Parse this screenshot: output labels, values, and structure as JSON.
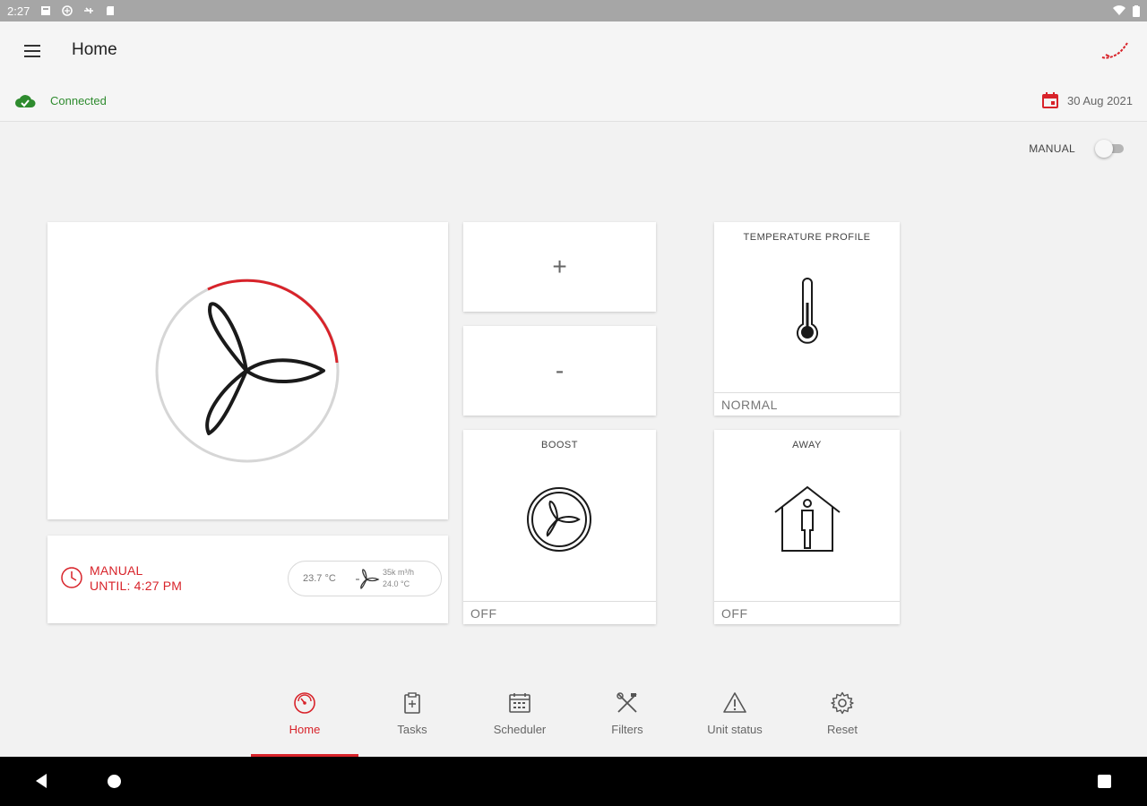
{
  "status_bar": {
    "time": "2:27"
  },
  "app_bar": {
    "title": "Home"
  },
  "connection": {
    "status": "Connected"
  },
  "date": "30 Aug 2021",
  "manual_toggle": {
    "label": "MANUAL",
    "on": false
  },
  "status_card": {
    "mode": "MANUAL",
    "until": "UNTIL: 4:27 PM",
    "temp_in": "23.7 °C",
    "airflow": "35k m³/h",
    "temp_out": "24.0 °C"
  },
  "controls": {
    "plus": "+",
    "minus": "-"
  },
  "boost": {
    "label": "BOOST",
    "state": "OFF"
  },
  "temperature_profile": {
    "label": "TEMPERATURE PROFILE",
    "value": "NORMAL"
  },
  "away": {
    "label": "AWAY",
    "state": "OFF"
  },
  "nav": [
    {
      "label": "Home",
      "icon": "gauge-icon",
      "active": true
    },
    {
      "label": "Tasks",
      "icon": "clipboard-icon"
    },
    {
      "label": "Scheduler",
      "icon": "calendar-icon"
    },
    {
      "label": "Filters",
      "icon": "tools-icon"
    },
    {
      "label": "Unit status",
      "icon": "warning-icon"
    },
    {
      "label": "Reset",
      "icon": "gear-icon"
    }
  ],
  "colors": {
    "accent": "#d8232a",
    "connected": "#2e8b2e"
  }
}
